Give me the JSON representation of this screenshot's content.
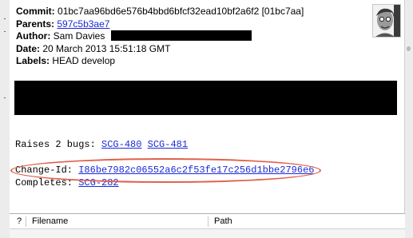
{
  "commit": {
    "commit_label": "Commit:",
    "commit_value": "01bc7aa96bd6e576b4bbd6bfcf32ead10bf2a6f2 [01bc7aa]",
    "parents_label": "Parents:",
    "parents_value": "597c5b3ae7",
    "author_label": "Author:",
    "author_value": "Sam Davies",
    "date_label": "Date:",
    "date_value": "20 March 2013 15:51:18 GMT",
    "labels_label": "Labels:",
    "labels_value": "HEAD develop"
  },
  "message": {
    "raises_text": "Raises 2 bugs: ",
    "bug1": "SCG-480",
    "bug2": "SCG-481",
    "changeid_label": "Change-Id: ",
    "changeid_value": "I86be7982c06552a6c2f53fe17c256d1bbe2796e6",
    "completes_label": "Completes: ",
    "completes_value": "SCG-282"
  },
  "file_table": {
    "col_status": "?",
    "col_filename": "Filename",
    "col_path": "Path"
  },
  "colors": {
    "link": "#1a2bd6",
    "highlight_oval": "#e0604c",
    "redaction": "#000000"
  },
  "icons": {
    "avatar": "user-avatar-photo"
  }
}
